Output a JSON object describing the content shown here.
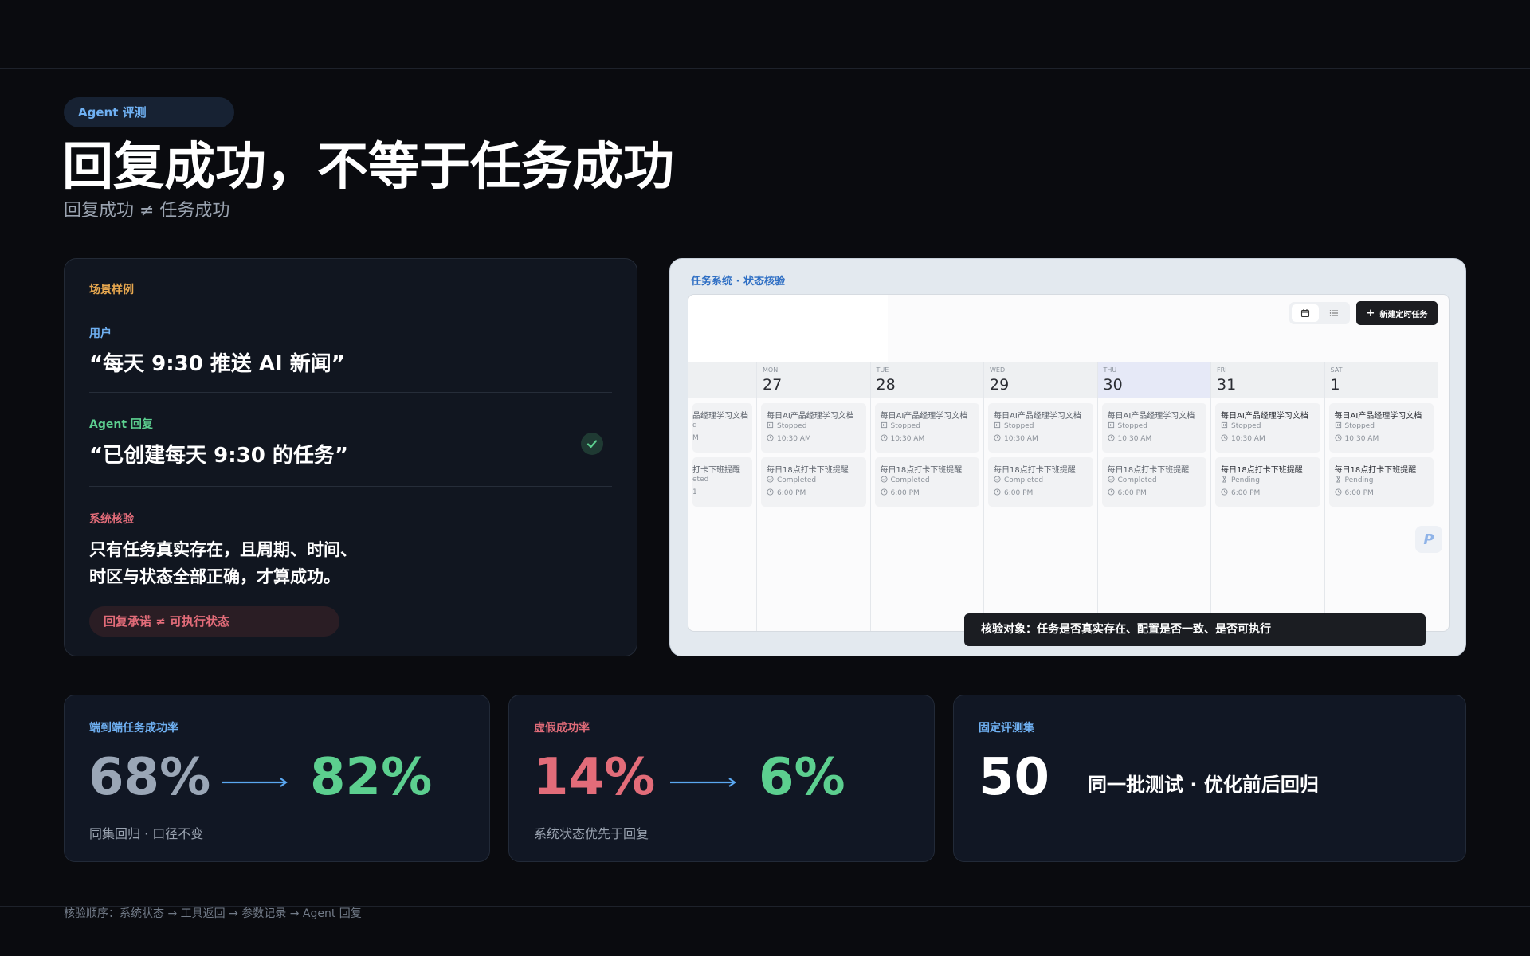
{
  "header": {
    "tag": "Agent 评测",
    "title": "回复成功，不等于任务成功",
    "subtitle": "回复成功 ≠ 任务成功"
  },
  "scenario": {
    "label": "场景样例",
    "user_label": "用户",
    "user_quote": "“每天 9:30 推送 AI 新闻”",
    "agent_label": "Agent 回复",
    "agent_quote": "“已创建每天 9:30 的任务”",
    "verify_label": "系统核验",
    "verify_line1": "只有任务真实存在，且周期、时间、",
    "verify_line2": "时区与状态全部正确，才算成功。",
    "pill": "回复承诺 ≠ 可执行状态"
  },
  "task_system": {
    "title": "任务系统 · 状态核验",
    "new_button": "新建定时任务",
    "banner": "核验对象：任务是否真实存在、配置是否一致、是否可执行",
    "partial_day": {
      "task1": "品经理学习文档",
      "task1_status": "d",
      "task1_time": "M",
      "task2": "打卡下班提醒",
      "task2_status": "eted",
      "task2_time": "1"
    },
    "days": [
      {
        "dow": "MON",
        "num": "27",
        "task1": "每日AI产品经理学习文档",
        "task1_status": "Stopped",
        "task1_time": "10:30 AM",
        "task2": "每日18点打卡下班提醒",
        "task2_status": "Completed",
        "task2_time": "6:00 PM"
      },
      {
        "dow": "TUE",
        "num": "28",
        "task1": "每日AI产品经理学习文档",
        "task1_status": "Stopped",
        "task1_time": "10:30 AM",
        "task2": "每日18点打卡下班提醒",
        "task2_status": "Completed",
        "task2_time": "6:00 PM"
      },
      {
        "dow": "WED",
        "num": "29",
        "task1": "每日AI产品经理学习文档",
        "task1_status": "Stopped",
        "task1_time": "10:30 AM",
        "task2": "每日18点打卡下班提醒",
        "task2_status": "Completed",
        "task2_time": "6:00 PM"
      },
      {
        "dow": "THU",
        "num": "30",
        "task1": "每日AI产品经理学习文档",
        "task1_status": "Stopped",
        "task1_time": "10:30 AM",
        "task2": "每日18点打卡下班提醒",
        "task2_status": "Completed",
        "task2_time": "6:00 PM"
      },
      {
        "dow": "FRI",
        "num": "31",
        "task1": "每日AI产品经理学习文档",
        "task1_status": "Stopped",
        "task1_time": "10:30 AM",
        "task2": "每日18点打卡下班提醒",
        "task2_status": "Pending",
        "task2_time": "6:00 PM"
      },
      {
        "dow": "SAT",
        "num": "1",
        "task1": "每日AI产品经理学习文档",
        "task1_status": "Stopped",
        "task1_time": "10:30 AM",
        "task2": "每日18点打卡下班提醒",
        "task2_status": "Pending",
        "task2_time": "6:00 PM"
      }
    ],
    "badge": "P"
  },
  "stats": [
    {
      "label": "端到端任务成功率",
      "before": "68%",
      "after": "82%",
      "sub": "同集回归 · 口径不变"
    },
    {
      "label": "虚假成功率",
      "before": "14%",
      "after": "6%",
      "sub": "系统状态优先于回复"
    },
    {
      "label": "固定评测集",
      "value": "50",
      "desc": "同一批测试 · 优化前后回归"
    }
  ],
  "footer": "核验顺序：系统状态 → 工具返回 → 参数记录 → Agent 回复",
  "colors": {
    "blue": "#6fb0f2",
    "green": "#5ccf8f",
    "red": "#e26c79",
    "orange": "#e8a84f",
    "gray_number": "#9aa6b6"
  }
}
